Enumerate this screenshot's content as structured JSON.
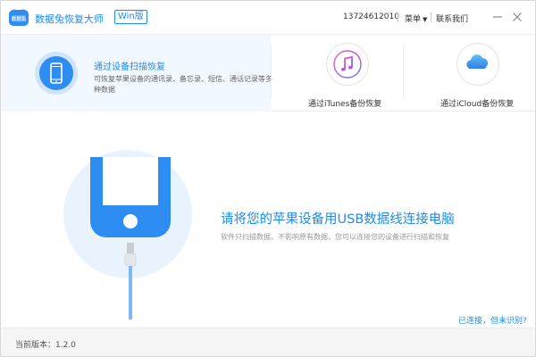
{
  "titlebar": {
    "app_title": "数据兔恢复大师",
    "edition": "Win版",
    "phone": "13724612010",
    "menu_label": "菜单",
    "contact_label": "联系我们",
    "logo_text": "数据兔"
  },
  "modes": [
    {
      "title": "通过设备扫描恢复",
      "desc": "可恢复苹果设备的通讯录、备忘录、短信、通话记录等多种数据",
      "icon": "iphone-icon"
    },
    {
      "title": "通过iTunes备份恢复",
      "icon": "itunes-icon"
    },
    {
      "title": "通过iCloud备份恢复",
      "icon": "icloud-icon"
    }
  ],
  "main": {
    "headline": "请将您的苹果设备用USB数据线连接电脑",
    "subline": "软件只扫描数据，不影响原有数据，您可以连接您的设备进行扫描和恢复",
    "connected_link": "已连接，但未识别?"
  },
  "status": {
    "version": "当前版本：1.2.0"
  },
  "colors": {
    "accent": "#1a8cf0",
    "active_tab_bg": "#f2f8ff",
    "illustration_bg": "#e8f3fd"
  }
}
